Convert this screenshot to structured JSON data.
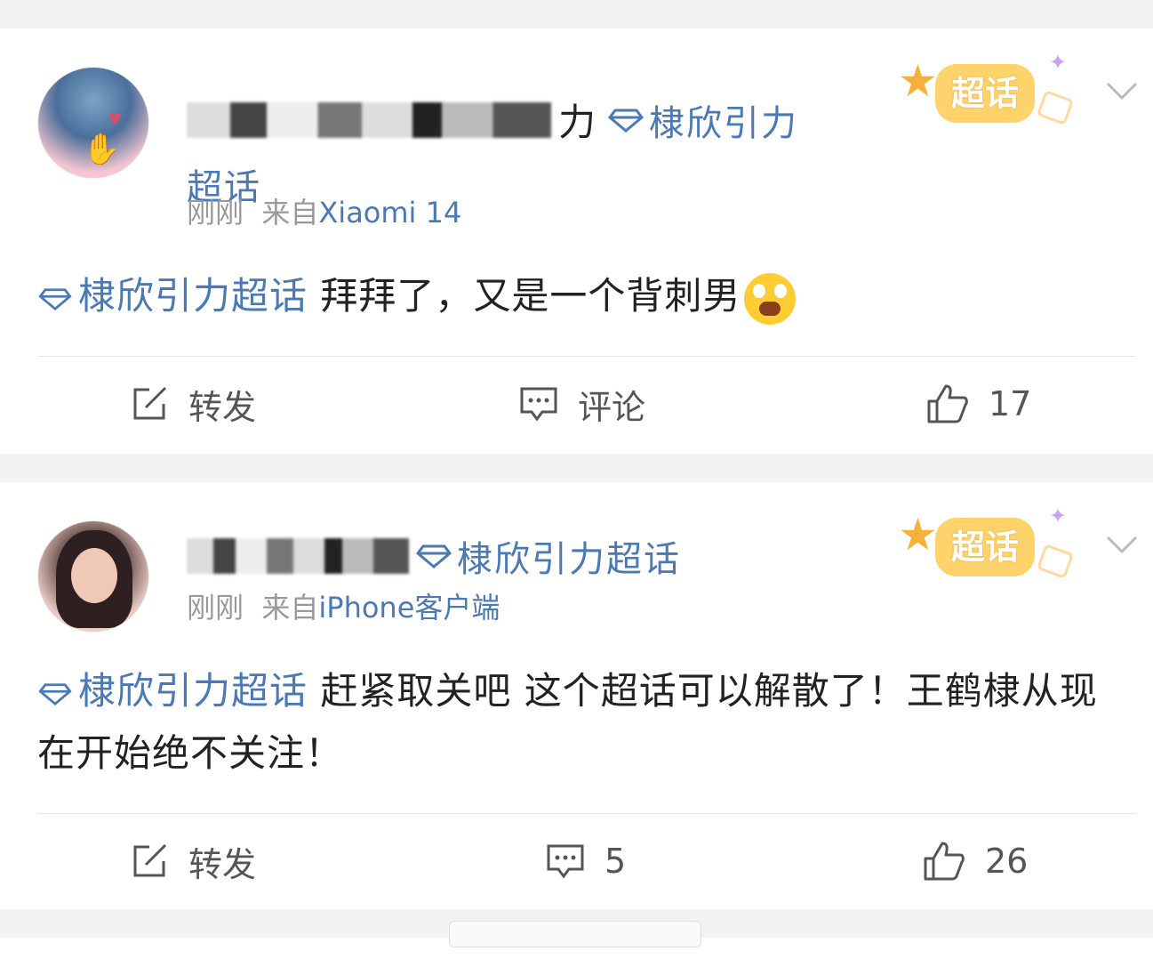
{
  "posts": [
    {
      "user_name_suffix": "力",
      "topic_label": "棣欣引力",
      "topic_label_line2": "超话",
      "time": "刚刚",
      "from_prefix": "来自",
      "source": "Xiaomi 14",
      "badge_text": "超话",
      "content_topic": "棣欣引力超话",
      "content_text": " 拜拜了，又是一个背刺男",
      "actions": {
        "repost": "转发",
        "comment": "评论",
        "likes": "17"
      }
    },
    {
      "topic_label": "棣欣引力超话",
      "time": "刚刚",
      "from_prefix": "来自",
      "source": "iPhone客户端",
      "badge_text": "超话",
      "content_topic": "棣欣引力超话",
      "content_text": "  赶紧取关吧 这个超话可以解散了！王鹤棣从现在开始绝不关注！",
      "actions": {
        "repost": "转发",
        "comment": "5",
        "likes": "26"
      }
    }
  ],
  "colors": {
    "link": "#4a79b5",
    "meta": "#999999",
    "badge": "#ffd36b"
  }
}
